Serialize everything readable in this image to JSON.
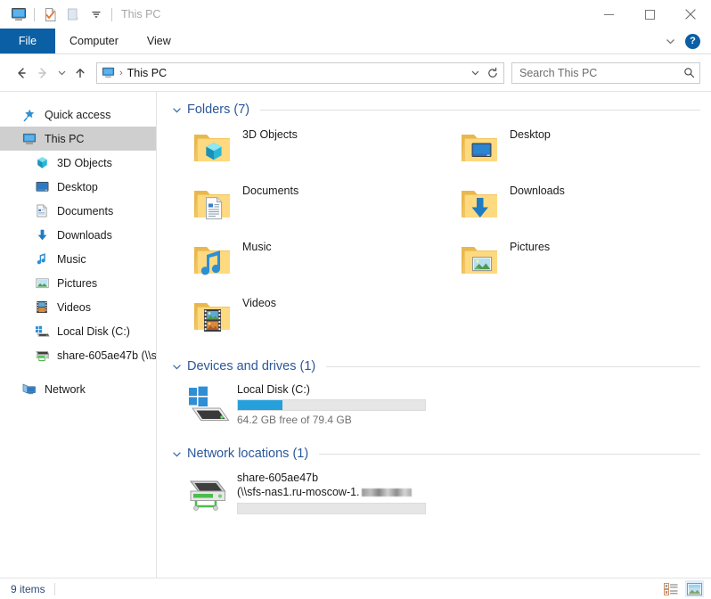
{
  "window": {
    "title": "This PC",
    "quick_access_icons": [
      "this-pc-monitor-icon",
      "properties-checkmark-icon",
      "new-folder-icon",
      "customize-qat-chevron-icon"
    ],
    "controls": {
      "minimize": "—",
      "maximize": "☐",
      "close": "✕"
    }
  },
  "ribbon": {
    "tabs": [
      {
        "label": "File",
        "active_style": "file"
      },
      {
        "label": "Computer",
        "active_style": ""
      },
      {
        "label": "View",
        "active_style": ""
      }
    ],
    "collapse_label": "⌄",
    "help_label": "?"
  },
  "address": {
    "back_label": "←",
    "forward_label": "→",
    "recent_label": "⌄",
    "up_label": "↑",
    "crumb_icon": "this-pc-monitor-icon",
    "crumb_text": "This PC",
    "crumb_sep": "›",
    "dropdown_label": "⌄",
    "refresh_label": "↻"
  },
  "search": {
    "placeholder": "Search This PC",
    "icon": "magnifier-icon"
  },
  "sidebar": {
    "items": [
      {
        "label": "Quick access",
        "icon": "star-pin-icon",
        "level": 0,
        "selected": false
      },
      {
        "label": "This PC",
        "icon": "monitor-icon",
        "level": 0,
        "selected": true
      },
      {
        "label": "3D Objects",
        "icon": "cube-3d-icon",
        "level": 1,
        "selected": false
      },
      {
        "label": "Desktop",
        "icon": "desktop-icon",
        "level": 1,
        "selected": false
      },
      {
        "label": "Documents",
        "icon": "document-icon",
        "level": 1,
        "selected": false
      },
      {
        "label": "Downloads",
        "icon": "download-arrow-icon",
        "level": 1,
        "selected": false
      },
      {
        "label": "Music",
        "icon": "music-note-icon",
        "level": 1,
        "selected": false
      },
      {
        "label": "Pictures",
        "icon": "picture-icon",
        "level": 1,
        "selected": false
      },
      {
        "label": "Videos",
        "icon": "video-filmstrip-icon",
        "level": 1,
        "selected": false
      },
      {
        "label": "Local Disk (C:)",
        "icon": "hard-drive-icon",
        "level": 1,
        "selected": false
      },
      {
        "label": "share-605ae47b (\\\\s",
        "icon": "network-drive-icon",
        "level": 1,
        "selected": false
      },
      {
        "label": "Network",
        "icon": "network-icon",
        "level": 0,
        "selected": false,
        "gap_before": true
      }
    ]
  },
  "content": {
    "sections": [
      {
        "key": "folders",
        "title": "Folders (7)",
        "chevron": "⌄"
      },
      {
        "key": "devices",
        "title": "Devices and drives (1)",
        "chevron": "⌄"
      },
      {
        "key": "network",
        "title": "Network locations (1)",
        "chevron": "⌄"
      }
    ],
    "folders": [
      {
        "label": "3D Objects",
        "icon": "folder-3d-objects-icon"
      },
      {
        "label": "Desktop",
        "icon": "folder-desktop-icon"
      },
      {
        "label": "Documents",
        "icon": "folder-documents-icon"
      },
      {
        "label": "Downloads",
        "icon": "folder-downloads-icon"
      },
      {
        "label": "Music",
        "icon": "folder-music-icon"
      },
      {
        "label": "Pictures",
        "icon": "folder-pictures-icon"
      },
      {
        "label": "Videos",
        "icon": "folder-videos-icon"
      }
    ],
    "drives": [
      {
        "name": "Local Disk (C:)",
        "icon": "windows-hard-drive-icon",
        "capacity_text": "64.2 GB free of 79.4 GB",
        "free_gb": 64.2,
        "total_gb": 79.4,
        "used_percent": 19
      }
    ],
    "network_locations": [
      {
        "name": "share-605ae47b",
        "path_visible": "(\\\\sfs-nas1.ru-moscow-1.",
        "path_redacted": true,
        "icon": "network-share-drive-icon",
        "used_percent": 0
      }
    ]
  },
  "statusbar": {
    "item_count_text": "9 items",
    "views": [
      {
        "name": "details-view-button",
        "active": false
      },
      {
        "name": "large-icons-view-button",
        "active": true
      }
    ]
  },
  "colors": {
    "accent_blue": "#0b5fa4",
    "section_header": "#2b579a",
    "progress_fill": "#26a0da",
    "progress_track": "#e6e6e6",
    "selection_gray": "#cfcfcf",
    "folder_yellow": "#fcd77f"
  }
}
